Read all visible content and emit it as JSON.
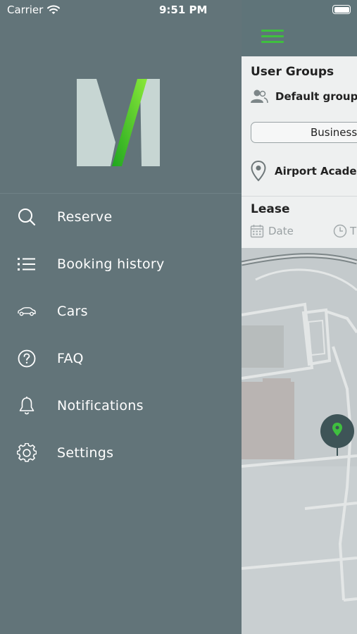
{
  "status_bar": {
    "carrier": "Carrier",
    "time": "9:51 PM"
  },
  "drawer": {
    "menu": [
      {
        "label": "Reserve",
        "icon": "search-icon"
      },
      {
        "label": "Booking history",
        "icon": "list-icon"
      },
      {
        "label": "Cars",
        "icon": "car-icon"
      },
      {
        "label": "FAQ",
        "icon": "help-icon"
      },
      {
        "label": "Notifications",
        "icon": "bell-icon"
      },
      {
        "label": "Settings",
        "icon": "gear-icon"
      }
    ]
  },
  "main": {
    "user_groups_title": "User Groups",
    "default_group": "Default group",
    "segment_label": "Business",
    "location": "Airport Academ",
    "lease_title": "Lease",
    "date_placeholder": "Date",
    "time_placeholder": "T"
  },
  "colors": {
    "drawer_bg": "#627479",
    "accent_green": "#3fbf3f",
    "topbar": "#5f7479"
  }
}
